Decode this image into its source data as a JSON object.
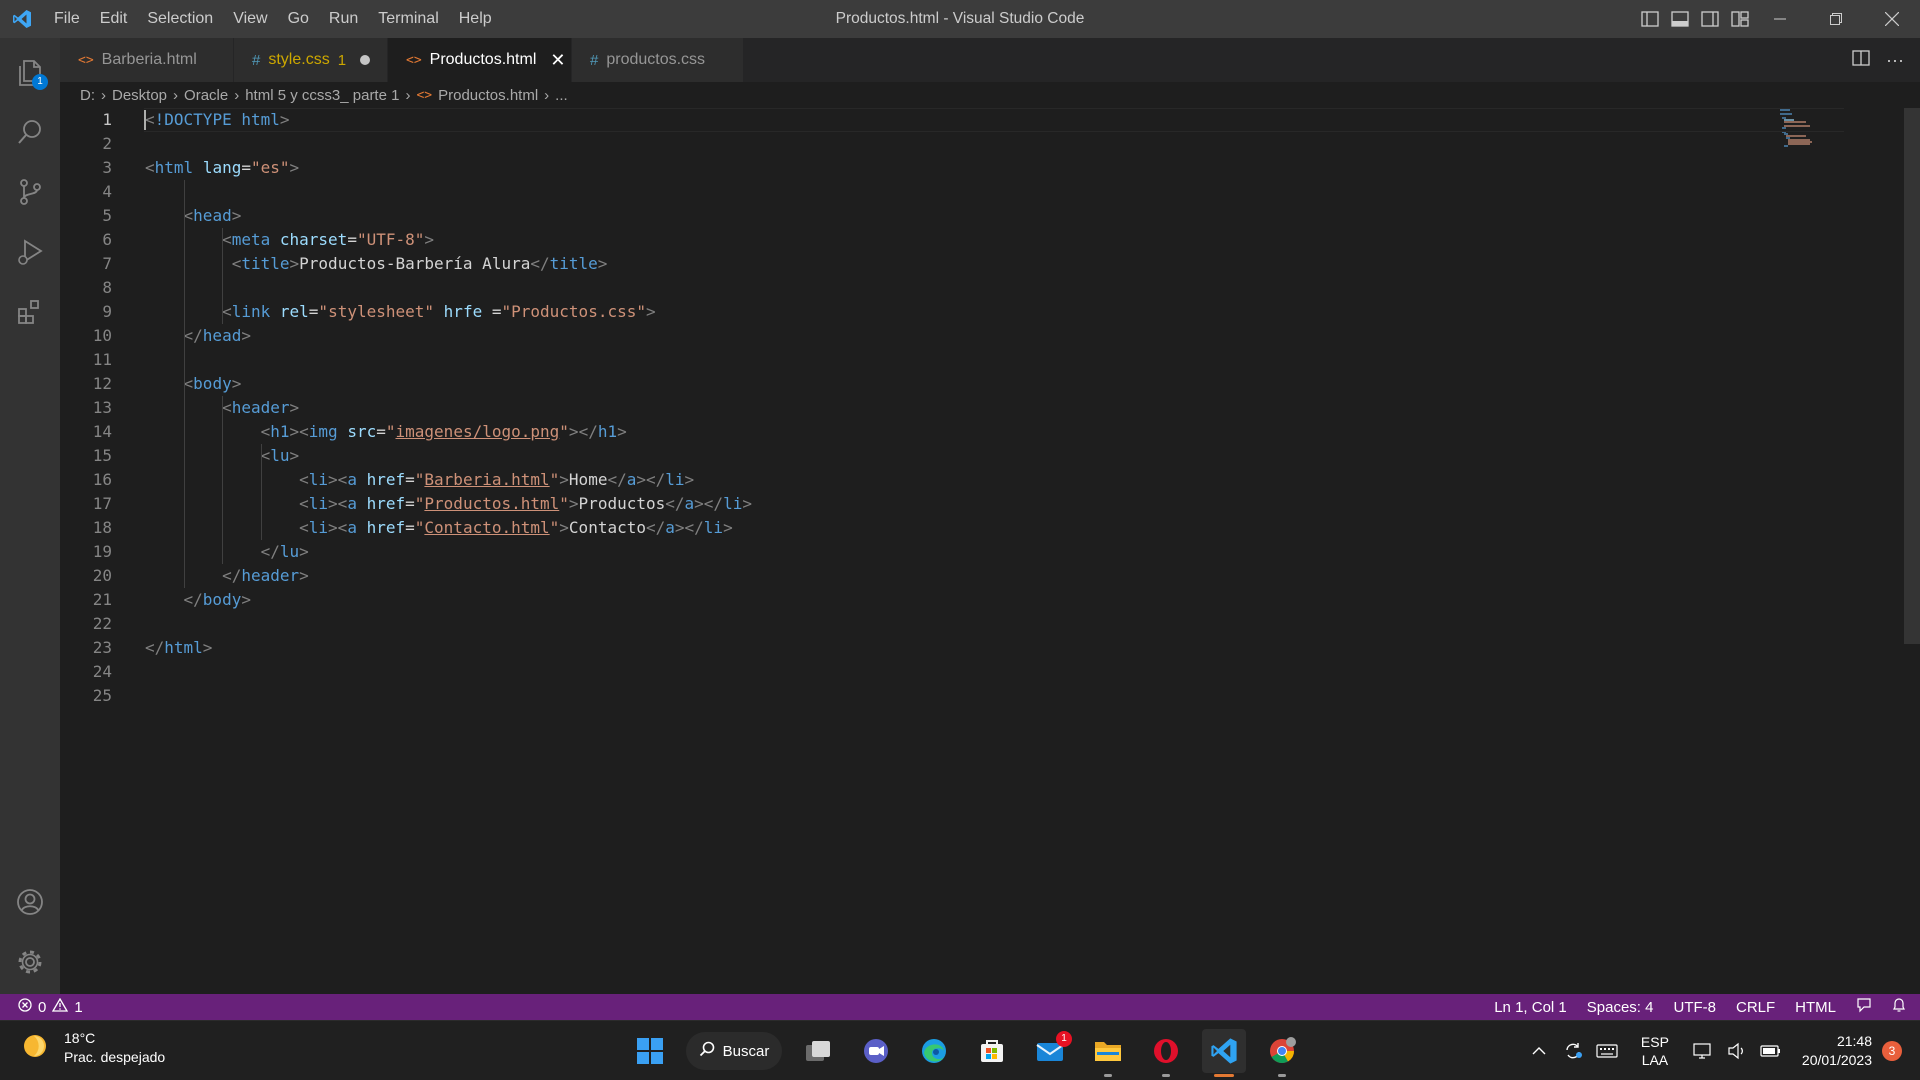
{
  "titlebar": {
    "window_title": "Productos.html - Visual Studio Code",
    "menu": [
      "File",
      "Edit",
      "Selection",
      "View",
      "Go",
      "Run",
      "Terminal",
      "Help"
    ]
  },
  "activity": {
    "explorer_badge": "1"
  },
  "tabs": [
    {
      "name": "Barberia.html",
      "type": "html",
      "active": false
    },
    {
      "name": "style.css",
      "type": "css",
      "problems": "1",
      "modified": true,
      "active": false
    },
    {
      "name": "Productos.html",
      "type": "html",
      "active": true
    },
    {
      "name": "productos.css",
      "type": "css",
      "active": false
    }
  ],
  "breadcrumb": {
    "items": [
      "D:",
      "Desktop",
      "Oracle",
      "html 5 y ccss3_ parte 1",
      "Productos.html",
      "..."
    ]
  },
  "editor": {
    "current_line": "1",
    "line_numbers": [
      "1",
      "2",
      "3",
      "4",
      "5",
      "6",
      "7",
      "8",
      "9",
      "10",
      "11",
      "12",
      "13",
      "14",
      "15",
      "16",
      "17",
      "18",
      "19",
      "20",
      "21",
      "22",
      "23",
      "24",
      "25"
    ],
    "lines": [
      "<!DOCTYPE html>",
      "",
      "<html lang=\"es\">",
      "",
      "    <head>",
      "        <meta charset=\"UTF-8\">",
      "         <title>Productos-Barbería Alura</title>",
      "",
      "        <link rel=\"stylesheet\" hrfe =\"Productos.css\">",
      "    </head>",
      "",
      "    <body>",
      "        <header>",
      "            <h1><img src=\"imagenes/logo.png\"></h1>",
      "            <lu>",
      "                <li><a href=\"Barberia.html\">Home</a></li>",
      "                <li><a href=\"Productos.html\">Productos</a></li>",
      "                <li><a href=\"Contacto.html\">Contacto</a></li>",
      "            </lu>",
      "        </header>",
      "    </body>",
      "",
      "</html>",
      "",
      ""
    ]
  },
  "statusbar": {
    "errors": "0",
    "warnings": "1",
    "position": "Ln 1, Col 1",
    "spaces": "Spaces: 4",
    "encoding": "UTF-8",
    "eol": "CRLF",
    "language": "HTML"
  },
  "taskbar": {
    "weather_temp": "18°C",
    "weather_desc": "Prac. despejado",
    "search_label": "Buscar",
    "mail_badge": "1",
    "lang_top": "ESP",
    "lang_bottom": "LAA",
    "time": "21:48",
    "date": "20/01/2023",
    "notifications": "3"
  },
  "colors": {
    "statusbar": "#68217a",
    "tag": "#569cd6",
    "attribute": "#9cdcfe",
    "string": "#ce9178",
    "html_icon": "#e37933",
    "css_icon": "#519aba"
  }
}
